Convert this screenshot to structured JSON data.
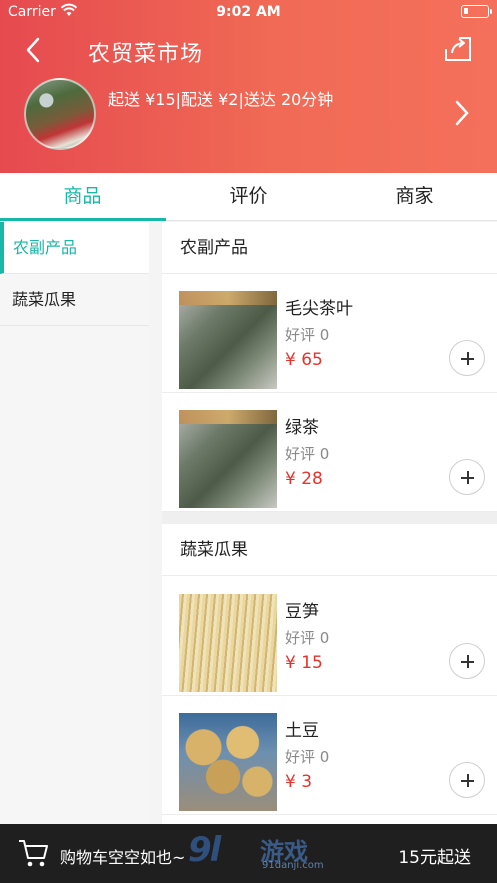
{
  "status_bar": {
    "carrier": "Carrier",
    "time": "9:02 AM"
  },
  "header": {
    "title": "农贸菜市场",
    "info": "起送 ¥15|配送 ¥2|送达 20分钟"
  },
  "tabs": [
    {
      "label": "商品",
      "active": true
    },
    {
      "label": "评价",
      "active": false
    },
    {
      "label": "商家",
      "active": false
    }
  ],
  "sidebar": {
    "items": [
      {
        "label": "农副产品",
        "active": true
      },
      {
        "label": "蔬菜瓜果",
        "active": false
      }
    ]
  },
  "sections": [
    {
      "title": "农副产品",
      "products": [
        {
          "name": "毛尖茶叶",
          "rating": "好评 0",
          "price": "¥ 65",
          "image": "tea-leaves-bag"
        },
        {
          "name": "绿茶",
          "rating": "好评 0",
          "price": "¥ 28",
          "image": "tea-leaves-bag"
        }
      ]
    },
    {
      "title": "蔬菜瓜果",
      "products": [
        {
          "name": "豆笋",
          "rating": "好评 0",
          "price": "¥ 15",
          "image": "bean-sprouts"
        },
        {
          "name": "土豆",
          "rating": "好评 0",
          "price": "¥ 3",
          "image": "potatoes"
        }
      ]
    }
  ],
  "bottom_bar": {
    "cart_text": "购物车空空如也~",
    "min_order": "15元起送",
    "watermark_main": "9l",
    "watermark_sub": "游戏",
    "watermark_url": "91danji.com"
  },
  "colors": {
    "accent": "#18b8a8",
    "header_start": "#e64a4f",
    "header_end": "#f5705a",
    "price": "#e8322c",
    "bottom_bar": "#1f1f1f"
  }
}
